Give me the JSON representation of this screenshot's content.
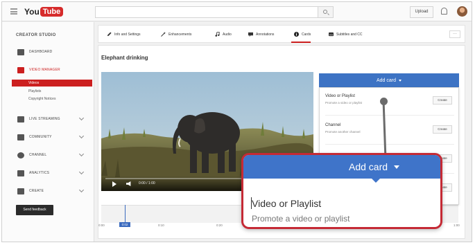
{
  "header": {
    "logo_you": "You",
    "logo_tube": "Tube",
    "logo_sup": "",
    "upload": "Upload"
  },
  "sidebar": {
    "title": "CREATOR STUDIO",
    "items": [
      {
        "label": "DASHBOARD",
        "icon": "dashboard-icon"
      },
      {
        "label": "VIDEO MANAGER",
        "icon": "video-manager-icon"
      },
      {
        "label": "LIVE STREAMING",
        "icon": "live-icon"
      },
      {
        "label": "COMMUNITY",
        "icon": "community-icon"
      },
      {
        "label": "CHANNEL",
        "icon": "channel-icon"
      },
      {
        "label": "ANALYTICS",
        "icon": "analytics-icon"
      },
      {
        "label": "CREATE",
        "icon": "create-icon"
      }
    ],
    "subitems": [
      "Videos",
      "Playlists",
      "Copyright Notices"
    ],
    "feedback": "Send feedback"
  },
  "tabs": [
    {
      "label": "Info and Settings",
      "icon": "pencil-icon"
    },
    {
      "label": "Enhancements",
      "icon": "wand-icon"
    },
    {
      "label": "Audio",
      "icon": "music-icon"
    },
    {
      "label": "Annotations",
      "icon": "annotation-icon"
    },
    {
      "label": "Cards",
      "icon": "info-icon"
    },
    {
      "label": "Subtitles and CC",
      "icon": "subtitles-icon"
    }
  ],
  "more": "···",
  "video": {
    "title": "Elephant drinking",
    "time": "0:00 / 1:00"
  },
  "timeline": {
    "ticks": [
      "0:00",
      "0:10",
      "0:20",
      "0:30",
      "1:00"
    ],
    "cursor": "0:02"
  },
  "addcard": {
    "label": "Add card",
    "options": [
      {
        "title": "Video or Playlist",
        "desc": "Promote a video or playlist",
        "button": "Create"
      },
      {
        "title": "Channel",
        "desc": "Promote another channel",
        "button": "Create"
      },
      {
        "title": "",
        "desc": "",
        "button": "Create"
      },
      {
        "title": "",
        "desc": "",
        "button": "Create"
      }
    ]
  },
  "callout": {
    "head": "Add card",
    "title": "Video or Playlist",
    "desc": "Promote a video or playlist"
  },
  "colors": {
    "brand_red": "#cc1f1f",
    "accent_blue": "#3f74c9",
    "callout_border": "#c52a35"
  }
}
